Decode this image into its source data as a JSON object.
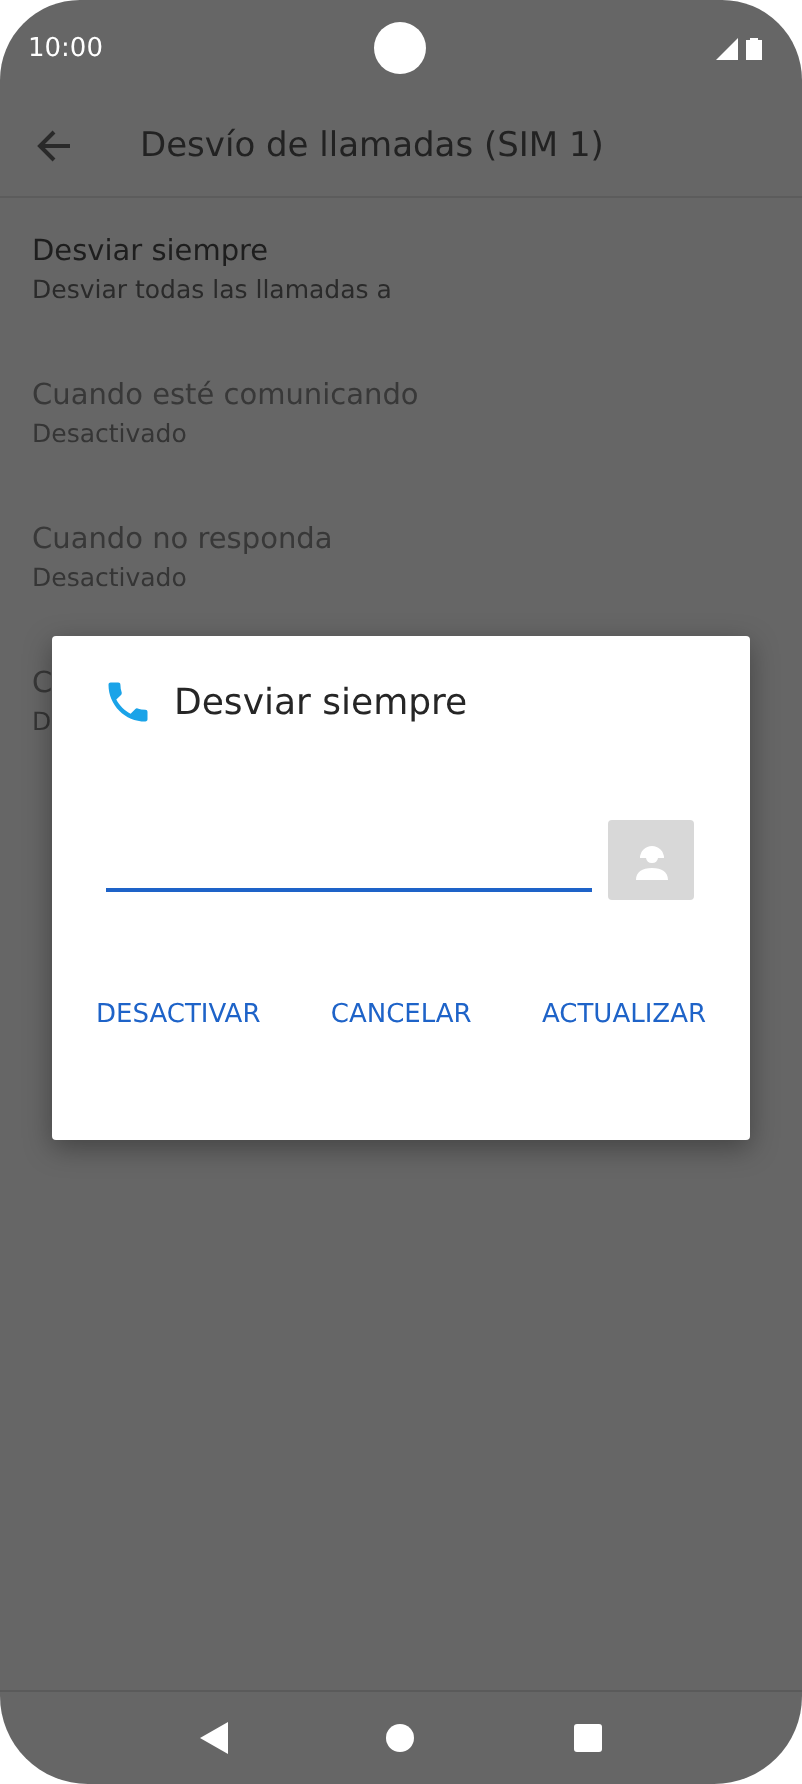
{
  "status_bar": {
    "time": "10:00"
  },
  "toolbar": {
    "title": "Desvío de llamadas (SIM 1)"
  },
  "items": [
    {
      "title": "Desviar siempre",
      "summary": "Desviar todas las llamadas a",
      "disabled": false
    },
    {
      "title": "Cuando esté comunicando",
      "summary": "Desactivado",
      "disabled": true
    },
    {
      "title": "Cuando no responda",
      "summary": "Desactivado",
      "disabled": true
    },
    {
      "title": "C",
      "summary": "D",
      "disabled": true
    }
  ],
  "dialog": {
    "title": "Desviar siempre",
    "buttons": [
      "DESACTIVAR",
      "CANCELAR",
      "ACTUALIZAR"
    ]
  }
}
